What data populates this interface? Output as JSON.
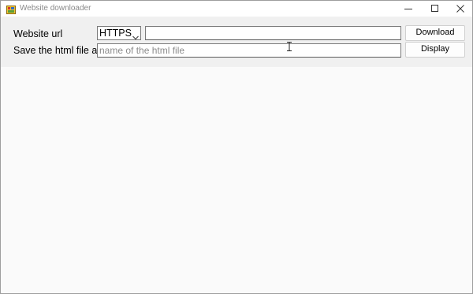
{
  "window": {
    "title": "Website downloader"
  },
  "form": {
    "url_label": "Website url",
    "protocol_selected": "HTTPS",
    "url_value": "",
    "save_label": "Save the html file as",
    "filename_value": "",
    "filename_placeholder": "name of the html file",
    "download_label": "Download",
    "display_label": "Display"
  },
  "icons": {
    "app": "app-icon",
    "minimize": "minimize-icon",
    "maximize": "maximize-icon",
    "close": "close-icon",
    "dropdown": "chevron-down-icon",
    "cursor": "text-cursor-icon"
  },
  "colors": {
    "panel": "#f0f0f0",
    "content": "#fafafa",
    "title_text": "#8a8a8a",
    "placeholder": "#8c8c8c"
  }
}
